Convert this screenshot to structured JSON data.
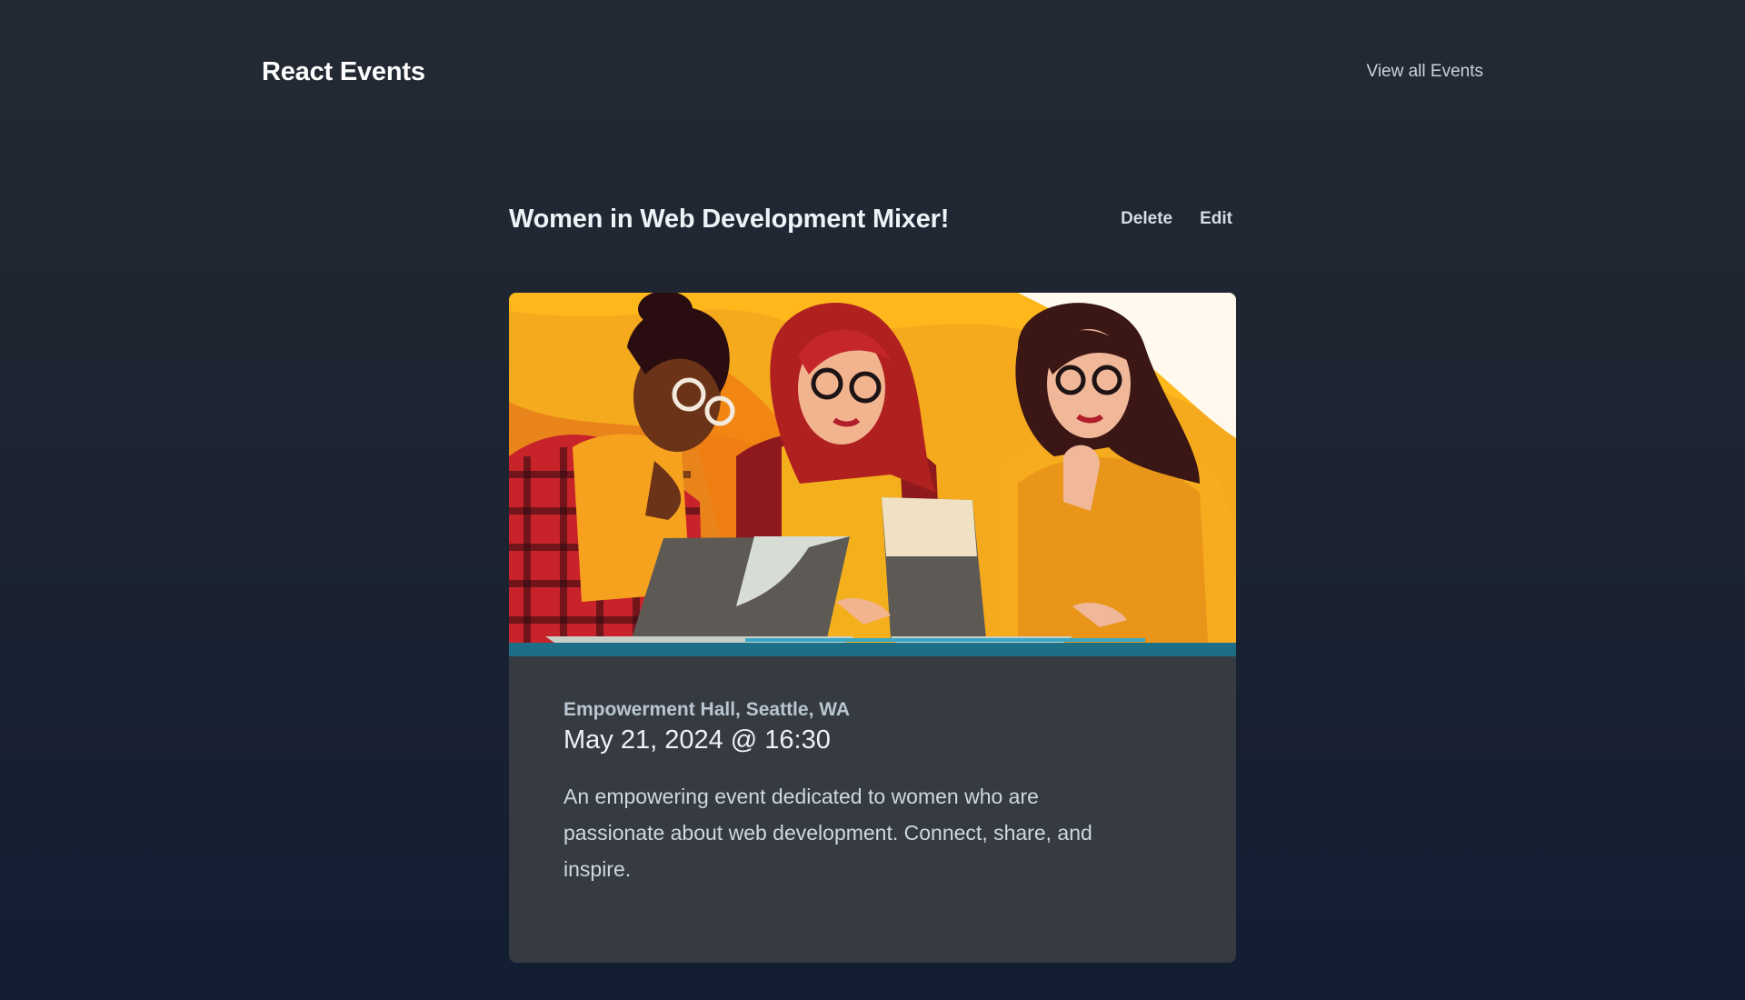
{
  "header": {
    "brand": "React Events",
    "nav_link": "View all Events"
  },
  "event": {
    "title": "Women in Web Development Mixer!",
    "actions": {
      "delete_label": "Delete",
      "edit_label": "Edit"
    },
    "image_alt": "Illustration of three women working on laptops",
    "location": "Empowerment Hall, Seattle, WA",
    "datetime": "May 21, 2024 @ 16:30",
    "description": "An empowering event dedicated to women who are passionate about web development. Connect, share, and inspire."
  },
  "colors": {
    "background_top": "#232a33",
    "background_bottom": "#131d33",
    "card": "#353b40",
    "illustration_orange": "#f5a623",
    "illustration_red": "#c0282d"
  }
}
